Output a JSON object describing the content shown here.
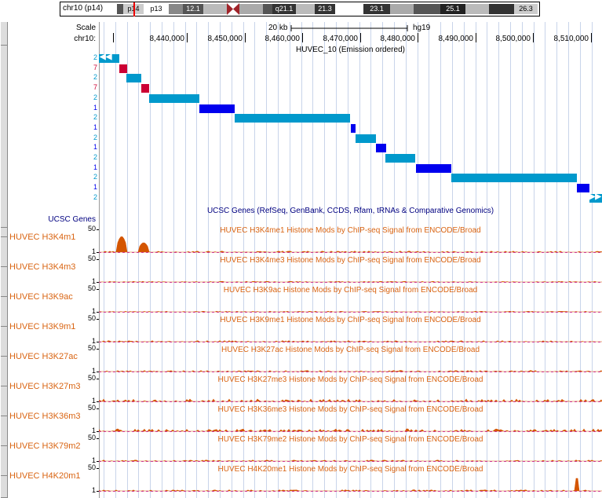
{
  "colors": {
    "state2": "#0099cc",
    "state1": "#0000ee",
    "state7": "#cc0033",
    "signal": "#d45500",
    "baseline": "#cc33cc",
    "track_title": "#d96412",
    "genes_title": "#000080",
    "grid": "#c8d4ea"
  },
  "ideogram": {
    "label": "chr10 (p14)",
    "bands": [
      "p14",
      "p13",
      "12.1",
      "q21.1",
      "21.3",
      "23.1",
      "25.1",
      "26.3"
    ]
  },
  "ruler": {
    "scale_label": "Scale",
    "scale_value": "20 kb",
    "assembly": "hg19",
    "chrom_label": "chr10:",
    "positions": [
      "8,440,000",
      "8,450,000",
      "8,460,000",
      "8,470,000",
      "8,480,000",
      "8,490,000",
      "8,500,000",
      "8,510,000"
    ]
  },
  "chromhmm": {
    "title": "HUVEC_10 (Emission ordered)",
    "rows": [
      {
        "state": "2",
        "start": 0.0,
        "end": 0.04,
        "arrow": "left"
      },
      {
        "state": "7",
        "start": 0.04,
        "end": 0.055
      },
      {
        "state": "2",
        "start": 0.055,
        "end": 0.085
      },
      {
        "state": "7",
        "start": 0.085,
        "end": 0.1
      },
      {
        "state": "2",
        "start": 0.1,
        "end": 0.2
      },
      {
        "state": "1",
        "start": 0.2,
        "end": 0.27
      },
      {
        "state": "2",
        "start": 0.27,
        "end": 0.5
      },
      {
        "state": "1",
        "start": 0.5,
        "end": 0.51
      },
      {
        "state": "2",
        "start": 0.51,
        "end": 0.55
      },
      {
        "state": "1",
        "start": 0.55,
        "end": 0.57
      },
      {
        "state": "2",
        "start": 0.57,
        "end": 0.63
      },
      {
        "state": "1",
        "start": 0.63,
        "end": 0.7
      },
      {
        "state": "2",
        "start": 0.7,
        "end": 0.95
      },
      {
        "state": "1",
        "start": 0.95,
        "end": 0.975
      },
      {
        "state": "2",
        "start": 0.975,
        "end": 1.0,
        "arrow": "right"
      }
    ]
  },
  "genes": {
    "label": "UCSC Genes",
    "title": "UCSC Genes (RefSeq, GenBank, CCDS, Rfam, tRNAs & Comparative Genomics)"
  },
  "signal_tracks": [
    {
      "name": "HUVEC H3K4m1",
      "title": "HUVEC H3K4me1 Histone Mods by ChIP-seq Signal from ENCODE/Broad",
      "max": "50",
      "min": "1"
    },
    {
      "name": "HUVEC H3K4m3",
      "title": "HUVEC H3K4me3 Histone Mods by ChIP-seq Signal from ENCODE/Broad",
      "max": "50",
      "min": "1"
    },
    {
      "name": "HUVEC H3K9ac",
      "title": "HUVEC H3K9ac Histone Mods by ChIP-seq Signal from ENCODE/Broad",
      "max": "50",
      "min": "1"
    },
    {
      "name": "HUVEC H3K9m1",
      "title": "HUVEC H3K9me1 Histone Mods by ChIP-seq Signal from ENCODE/Broad",
      "max": "50",
      "min": "1"
    },
    {
      "name": "HUVEC H3K27ac",
      "title": "HUVEC H3K27ac Histone Mods by ChIP-seq Signal from ENCODE/Broad",
      "max": "50",
      "min": "1"
    },
    {
      "name": "HUVEC H3K27m3",
      "title": "HUVEC H3K27me3 Histone Mods by ChIP-seq Signal from ENCODE/Broad",
      "max": "50",
      "min": "1"
    },
    {
      "name": "HUVEC H3K36m3",
      "title": "HUVEC H3K36me3 Histone Mods by ChIP-seq Signal from ENCODE/Broad",
      "max": "50",
      "min": "1"
    },
    {
      "name": "HUVEC H3K79m2",
      "title": "HUVEC H3K79me2 Histone Mods by ChIP-seq Signal from ENCODE/Broad",
      "max": "50",
      "min": "1"
    },
    {
      "name": "HUVEC H4K20m1",
      "title": "HUVEC H4K20me1 Histone Mods by ChIP-seq Signal from ENCODE/Broad",
      "max": "50",
      "min": "1"
    }
  ]
}
